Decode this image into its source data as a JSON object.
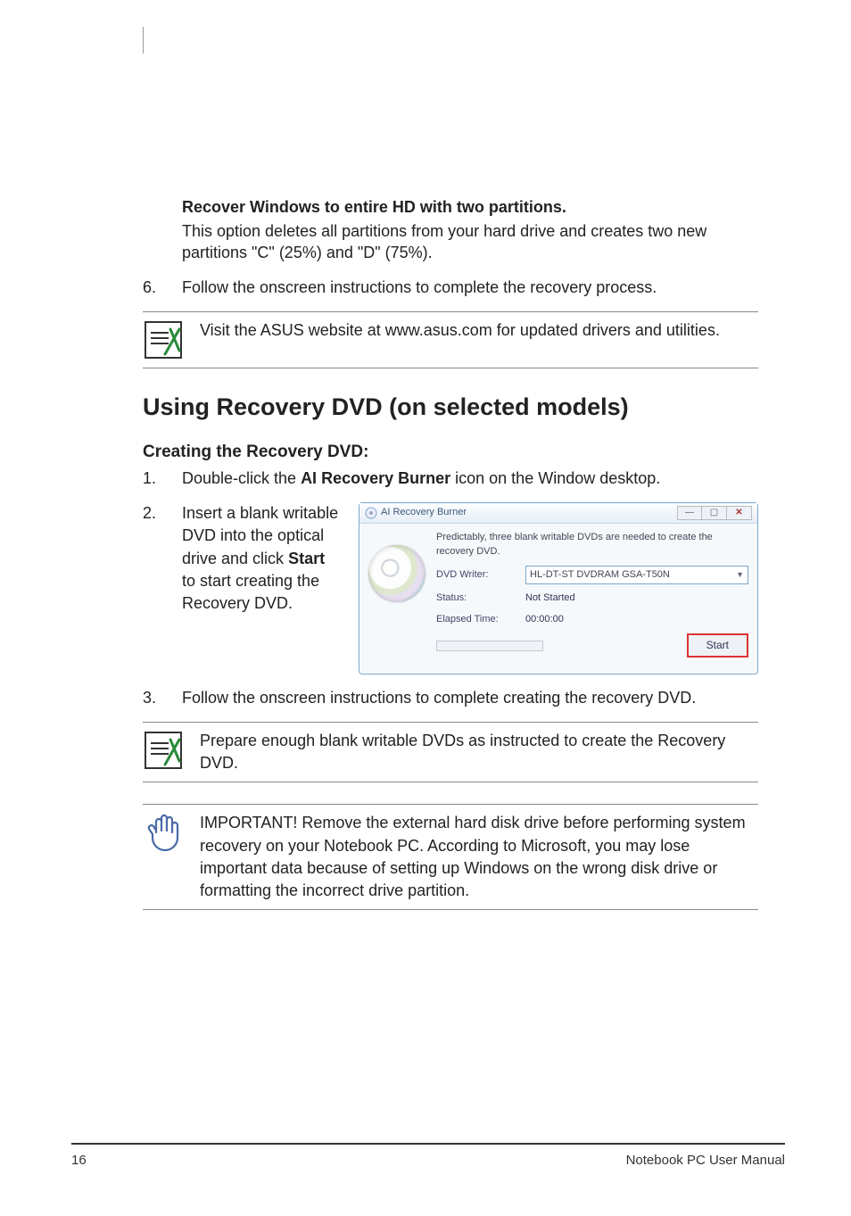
{
  "top": {
    "option_title": "Recover Windows to entire HD with two partitions.",
    "option_body": "This option deletes all partitions from your hard drive and creates two new partitions \"C\" (25%) and \"D\" (75%)."
  },
  "step6": {
    "num": "6.",
    "text": "Follow the onscreen instructions to complete the recovery process."
  },
  "note_asus": "Visit the ASUS website at www.asus.com for updated drivers and utilities.",
  "section_title": "Using Recovery DVD (on selected models)",
  "sub_title": "Creating the Recovery DVD:",
  "step1": {
    "num": "1.",
    "pre": "Double-click the ",
    "bold": "AI Recovery Burner",
    "post": " icon on the Window desktop."
  },
  "step2": {
    "num": "2.",
    "pre": "Insert a blank writable DVD into the optical drive and click ",
    "bold": "Start",
    "post": " to start creating the Recovery DVD."
  },
  "app": {
    "title": "AI Recovery Burner",
    "msg": "Predictably, three blank writable DVDs are needed to create the recovery DVD.",
    "labels": {
      "writer": "DVD Writer:",
      "status": "Status:",
      "elapsed": "Elapsed Time:"
    },
    "values": {
      "writer": "HL-DT-ST DVDRAM GSA-T50N",
      "status": "Not Started",
      "elapsed": "00:00:00"
    },
    "start_btn": "Start",
    "win_min": "—",
    "win_max": "▢",
    "win_close": "✕"
  },
  "step3": {
    "num": "3.",
    "text": "Follow the onscreen instructions to complete creating the recovery DVD."
  },
  "note_prepare": "Prepare enough blank writable DVDs as instructed to create the Recovery DVD.",
  "note_important": "IMPORTANT! Remove the external hard disk drive before performing system recovery on your Notebook PC. According to Microsoft, you may lose important data because of setting up Windows on the wrong disk drive or formatting the incorrect drive partition.",
  "footer": {
    "page": "16",
    "doc": "Notebook PC User Manual"
  }
}
